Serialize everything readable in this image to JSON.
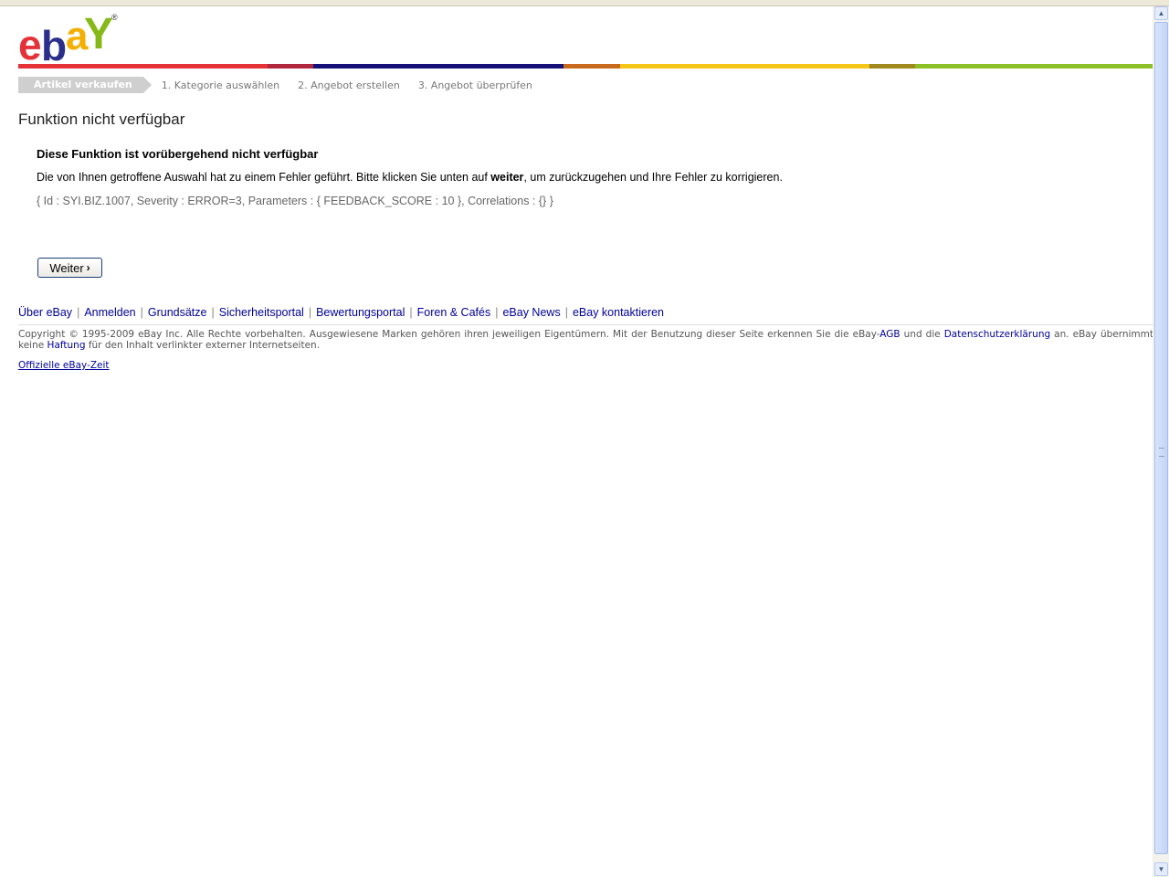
{
  "logo": {
    "letters": [
      "e",
      "b",
      "a",
      "Y"
    ],
    "registered": "®",
    "colors": [
      "#e53238",
      "#2b2f8a",
      "#f5af02",
      "#86b817"
    ]
  },
  "colorbar": [
    "#e53238",
    "#b0263c",
    "#14127a",
    "#c86a1e",
    "#f5c518",
    "#a0891f",
    "#8cbf26"
  ],
  "steps": {
    "active": "Artikel verkaufen",
    "step1": "1. Kategorie auswählen",
    "step2": "2. Angebot erstellen",
    "step3": "3. Angebot überprüfen"
  },
  "page_title": "Funktion nicht verfügbar",
  "message": {
    "heading": "Diese Funktion ist vorübergehend nicht verfügbar",
    "body_before": "Die von Ihnen getroffene Auswahl hat zu einem Fehler geführt. Bitte klicken Sie unten auf ",
    "body_bold": "weiter",
    "body_after": ", um zurückzugehen und Ihre Fehler zu korrigieren.",
    "code": "{ Id : SYI.BIZ.1007, Severity : ERROR=3, Parameters : { FEEDBACK_SCORE : 10 }, Correlations : {} }"
  },
  "continue_button": {
    "label": "Weiter",
    "chevron": "›"
  },
  "footer": {
    "links": [
      "Über eBay",
      "Anmelden",
      "Grundsätze",
      "Sicherheitsportal",
      "Bewertungsportal",
      "Foren & Cafés",
      "eBay News",
      "eBay kontaktieren"
    ],
    "separator": "|",
    "copyright_1": "Copyright © 1995-2009 eBay Inc. Alle Rechte vorbehalten. Ausgewiesene Marken gehören ihren jeweiligen Eigentümern. Mit der Benutzung dieser Seite erkennen Sie die eBay-",
    "agb_link": "AGB",
    "copyright_2": " und die ",
    "privacy_link": "Datenschutzerklärung",
    "copyright_3": " an. eBay übernimmt keine ",
    "liability_link": "Haftung",
    "copyright_4": " für den Inhalt verlinkter externer Internetseiten.",
    "official_time": "Offizielle eBay-Zeit"
  },
  "scrollbar": {
    "up_icon": "▲",
    "down_icon": "▼"
  }
}
